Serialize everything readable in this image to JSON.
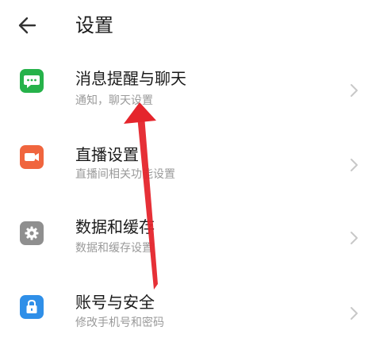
{
  "header": {
    "title": "设置",
    "back_icon": "arrow-left-icon"
  },
  "items": [
    {
      "title": "消息提醒与聊天",
      "subtitle": "通知，聊天设置",
      "icon": "chat-bubble-icon",
      "color": "#26b24a"
    },
    {
      "title": "直播设置",
      "subtitle": "直播间相关功能设置",
      "icon": "video-camera-icon",
      "color": "#f0653e"
    },
    {
      "title": "数据和缓存",
      "subtitle": "数据和缓存设置",
      "icon": "gear-icon",
      "color": "#8f8f8f"
    },
    {
      "title": "账号与安全",
      "subtitle": "修改手机号和密码",
      "icon": "lock-icon",
      "color": "#2f8fe8"
    }
  ],
  "annotation": {
    "color": "#e5252c"
  }
}
